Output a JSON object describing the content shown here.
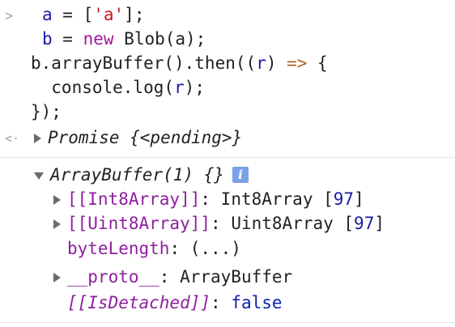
{
  "console": {
    "input_prompt": ">",
    "output_prompt": "<·",
    "input": {
      "line1": {
        "var": "a",
        "eq": " = [",
        "str": "'a'",
        "end": "];"
      },
      "line2": {
        "var": "b",
        "eq": " = ",
        "kw": "new",
        "rest": " Blob(a);"
      },
      "line3": {
        "pre": "b.arrayBuffer().then((",
        "var": "r",
        "mid": ") ",
        "arrow": "=>",
        "end": " {"
      },
      "line4": {
        "pre": "  console.log(",
        "var": "r",
        "end": ");"
      },
      "line5": "});"
    },
    "result": {
      "text": "Promise {<pending>}"
    },
    "log": {
      "header": "ArrayBuffer(1) {}",
      "info_icon_label": "i",
      "props": [
        {
          "key": "[[Int8Array]]",
          "sep": ": ",
          "type": "Int8Array ",
          "open": "[",
          "num": "97",
          "close": "]"
        },
        {
          "key": "[[Uint8Array]]",
          "sep": ": ",
          "type": "Uint8Array ",
          "open": "[",
          "num": "97",
          "close": "]"
        },
        {
          "key": "byteLength",
          "sep": ": ",
          "value": "(...)"
        },
        {
          "key": "__proto__",
          "sep": ": ",
          "value": "ArrayBuffer"
        },
        {
          "key": "[[IsDetached]]",
          "sep": ": ",
          "value": "false"
        }
      ]
    }
  }
}
